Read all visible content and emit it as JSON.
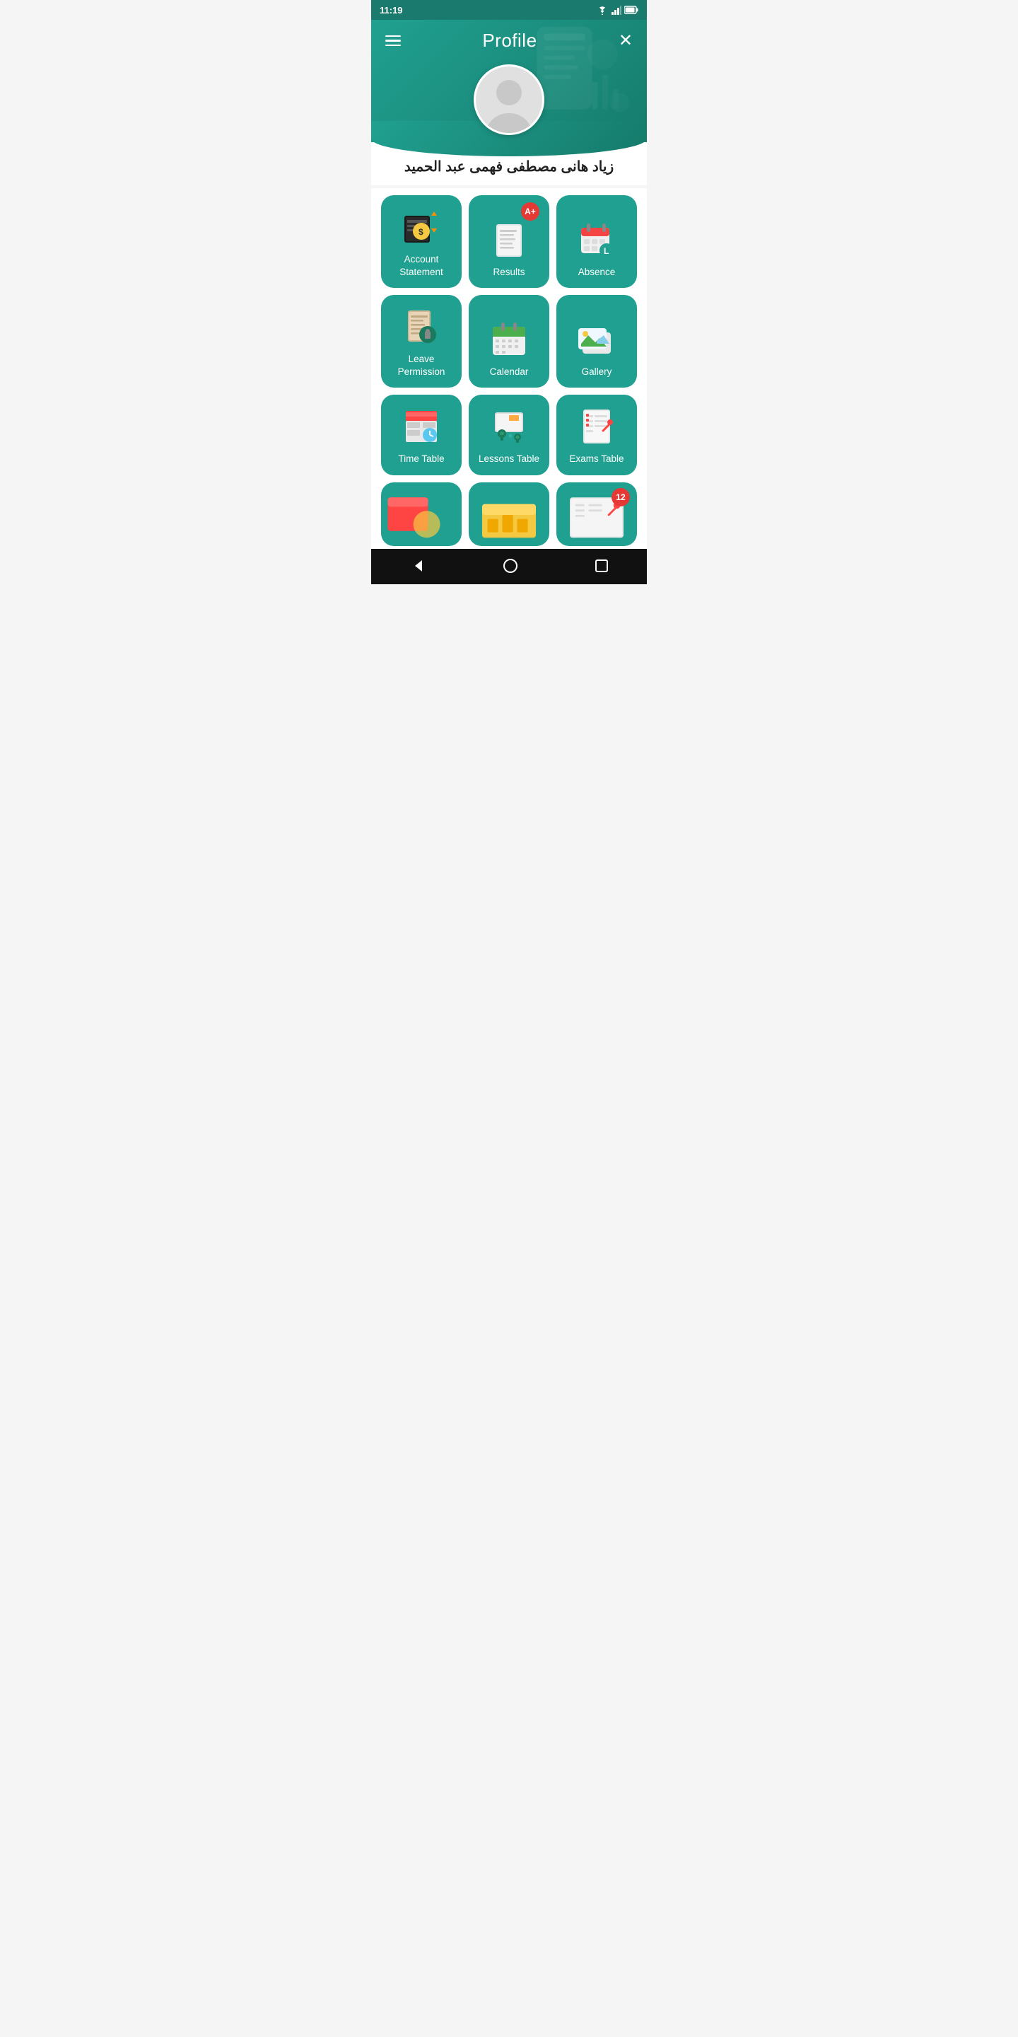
{
  "statusBar": {
    "time": "11:19"
  },
  "header": {
    "menuLabel": "menu",
    "title": "Profile",
    "closeLabel": "close"
  },
  "user": {
    "name": "زياد هانى مصطفى فهمى عبد الحميد"
  },
  "grid": {
    "items": [
      {
        "id": "account-statement",
        "label": "Account\nStatement",
        "badge": null,
        "iconType": "account"
      },
      {
        "id": "results",
        "label": "Results",
        "badge": "A+",
        "badgeColor": "#e53935",
        "iconType": "results"
      },
      {
        "id": "absence",
        "label": "Absence",
        "badge": null,
        "iconType": "absence"
      },
      {
        "id": "leave-permission",
        "label": "Leave\nPermission",
        "badge": null,
        "iconType": "leave"
      },
      {
        "id": "calendar",
        "label": "Calendar",
        "badge": null,
        "iconType": "calendar"
      },
      {
        "id": "gallery",
        "label": "Gallery",
        "badge": null,
        "iconType": "gallery"
      },
      {
        "id": "time-table",
        "label": "Time Table",
        "badge": null,
        "iconType": "timetable"
      },
      {
        "id": "lessons-table",
        "label": "Lessons Table",
        "badge": null,
        "iconType": "lessons"
      },
      {
        "id": "exams-table",
        "label": "Exams Table",
        "badge": null,
        "iconType": "exams"
      }
    ],
    "partialItems": [
      {
        "id": "partial-1",
        "label": "",
        "badge": null
      },
      {
        "id": "partial-2",
        "label": "",
        "badge": null
      },
      {
        "id": "partial-3",
        "label": "12",
        "badge": "12",
        "badgeColor": "#e53935"
      }
    ]
  },
  "navBar": {
    "back": "◀",
    "home": "⬤",
    "recent": "■"
  }
}
